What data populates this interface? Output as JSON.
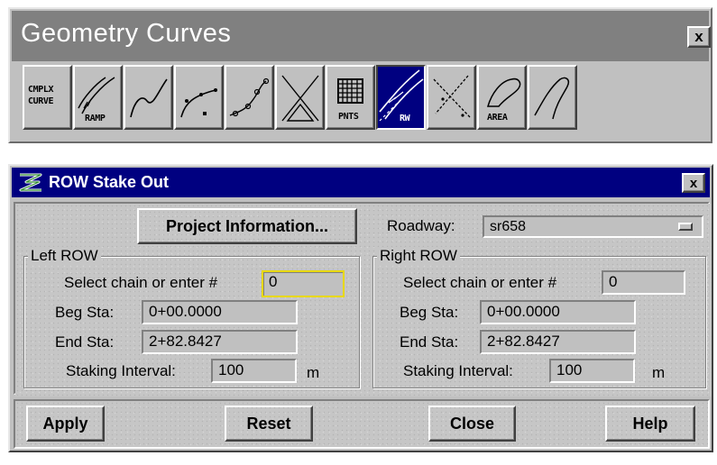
{
  "palette": {
    "title": "Geometry Curves",
    "close_label": "x",
    "tools": [
      {
        "name": "complex-curve",
        "label_1": "CMPLX",
        "label_2": "CURVE",
        "active": false
      },
      {
        "name": "ramp",
        "label": "RAMP",
        "active": false
      },
      {
        "name": "curve",
        "label": "",
        "active": false
      },
      {
        "name": "tangent",
        "label": "",
        "active": false
      },
      {
        "name": "spiral",
        "label": "",
        "active": false
      },
      {
        "name": "intersection",
        "label": "",
        "active": false
      },
      {
        "name": "points",
        "label": "PNTS",
        "active": false
      },
      {
        "name": "right-of-way",
        "label": "RW",
        "active": true
      },
      {
        "name": "crossing",
        "label": "",
        "active": false
      },
      {
        "name": "area",
        "label": "AREA",
        "active": false
      },
      {
        "name": "path",
        "label": "",
        "active": false
      }
    ]
  },
  "dialog": {
    "title": "ROW Stake Out",
    "close_label": "x",
    "project_button": "Project Information...",
    "roadway_label": "Roadway:",
    "roadway_value": "sr658",
    "left": {
      "group_title": "Left ROW",
      "select_label": "Select chain or enter #",
      "select_value": "0",
      "beg_label": "Beg Sta:",
      "beg_value": "0+00.0000",
      "end_label": "End Sta:",
      "end_value": "2+82.8427",
      "interval_label": "Staking Interval:",
      "interval_value": "100",
      "unit": "m"
    },
    "right": {
      "group_title": "Right ROW",
      "select_label": "Select chain or enter #",
      "select_value": "0",
      "beg_label": "Beg Sta:",
      "beg_value": "0+00.0000",
      "end_label": "End Sta:",
      "end_value": "2+82.8427",
      "interval_label": "Staking Interval:",
      "interval_value": "100",
      "unit": "m"
    },
    "buttons": {
      "apply": "Apply",
      "reset": "Reset",
      "close": "Close",
      "help": "Help"
    }
  },
  "colors": {
    "titlebar": "#000080",
    "palette_titlebar": "#808080",
    "face": "#c0c0c0",
    "active_field_border": "#e8d800"
  },
  "icons": {
    "palette_close": "close-icon",
    "dialog_app": "app-logo-icon",
    "dropdown": "dropdown-icon"
  }
}
